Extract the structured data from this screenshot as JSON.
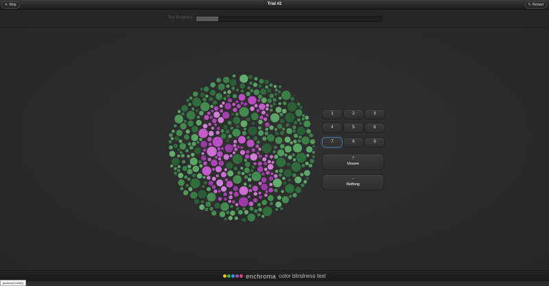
{
  "toolbar": {
    "stop_label": "Stop",
    "title": "Trial #2",
    "restart_label": "Restart"
  },
  "progress": {
    "label": "Test Progress",
    "fraction": 0.12
  },
  "answers": {
    "digits": [
      "1",
      "2",
      "3",
      "4",
      "5",
      "6",
      "7",
      "8",
      "9"
    ],
    "selected": "7",
    "unsure": {
      "glyph": "?",
      "label": "Unsure"
    },
    "nothing": {
      "glyph": "–",
      "label": "Nothing"
    }
  },
  "plate": {
    "digit_depicted": "6"
  },
  "footer": {
    "brand": "enchroma",
    "tagline": "color blindness test",
    "dot_colors": [
      "#f2c40f",
      "#43b54a",
      "#2e9bd6",
      "#9b4fbf",
      "#e23a7b"
    ]
  },
  "status_bar": {
    "url": "javascript:void(0)"
  },
  "colors": {
    "figure": "#b84fc0",
    "ground": "#3f8a4d"
  }
}
